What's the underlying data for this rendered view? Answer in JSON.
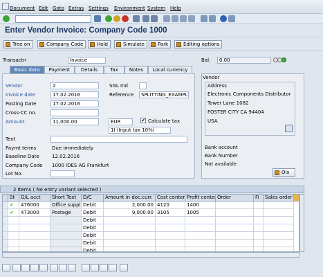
{
  "menu": [
    "Document",
    "Edit",
    "Goto",
    "Extras",
    "Settings",
    "Environment",
    "System",
    "Help"
  ],
  "toolbar": {
    "command_value": ""
  },
  "title": "Enter Vendor Invoice: Company Code 1000",
  "app_buttons": [
    "Tree on",
    "Company Code",
    "Hold",
    "Simulate",
    "Park",
    "Editing options"
  ],
  "transaction": {
    "label": "Transactn",
    "value": "Invoice"
  },
  "balance": {
    "label": "Bal.",
    "value": "0.00"
  },
  "tabs": [
    "Basic data",
    "Payment",
    "Details",
    "Tax",
    "Notes",
    "Local currency"
  ],
  "basic": {
    "vendor_label": "Vendor",
    "vendor_value": "2",
    "invoice_date_label": "Invoice date",
    "invoice_date_value": "17.02.2016",
    "posting_date_label": "Posting Date",
    "posting_date_value": "17.02.2016",
    "crosscc_label": "Cross-CC no.",
    "amount_label": "Amount",
    "amount_value": "11,000.00",
    "currency": "EUR",
    "calc_tax_label": "Calculate tax",
    "tax_code": "1I (Input tax 10%)",
    "sgl_label": "SGL Ind",
    "reference_label": "Reference",
    "reference_value": "SPLITTING_EXAMPL",
    "text_label": "Text",
    "payt_terms_label": "Paymt terms",
    "payt_terms_value": "Due immediately",
    "baseline_label": "Baseline Date",
    "baseline_value": "12.02.2016",
    "company_code_label": "Company Code",
    "company_code_value": "1000 IDES AG Frankfurt",
    "lot_label": "Lot No."
  },
  "vendor_box": {
    "header": "Vendor",
    "address_label": "Address",
    "address_lines": [
      "Electronic Components Distributor",
      "Tower Lane 1082",
      "FOSTER CITY CA  94404",
      "USA"
    ],
    "bank_account": "Bank account",
    "bank_number": "Bank Number",
    "not_available": "Not available",
    "ois_button": "OIs"
  },
  "items_title": "2 Items ( No entry variant selected )",
  "columns": [
    "St",
    "G/L acct",
    "Short Text",
    "D/C",
    "Amount in doc.curr.",
    "Cost center",
    "Profit center",
    "Order",
    "Fi",
    "Sales order"
  ],
  "rows": [
    {
      "st": "✔",
      "gl": "476000",
      "text": "Office supplie",
      "dc": "Debit",
      "amount": "2,000.00",
      "cc": "4120",
      "pc": "1400"
    },
    {
      "st": "✔",
      "gl": "473000",
      "text": "Postage",
      "dc": "Debit",
      "amount": "9,000.00",
      "cc": "3105",
      "pc": "1005"
    },
    {
      "st": "",
      "gl": "",
      "text": "",
      "dc": "Debit",
      "amount": "",
      "cc": "",
      "pc": ""
    },
    {
      "st": "",
      "gl": "",
      "text": "",
      "dc": "Debit",
      "amount": "",
      "cc": "",
      "pc": ""
    },
    {
      "st": "",
      "gl": "",
      "text": "",
      "dc": "Debit",
      "amount": "",
      "cc": "",
      "pc": ""
    },
    {
      "st": "",
      "gl": "",
      "text": "",
      "dc": "Debit",
      "amount": "",
      "cc": "",
      "pc": ""
    },
    {
      "st": "",
      "gl": "",
      "text": "",
      "dc": "Debit",
      "amount": "",
      "cc": "",
      "pc": ""
    }
  ],
  "colors": {
    "title": "#1f3a68",
    "active_tab": "#5f86b8",
    "label_blue": "#2a4fa0",
    "status_green": "#3aa636"
  }
}
